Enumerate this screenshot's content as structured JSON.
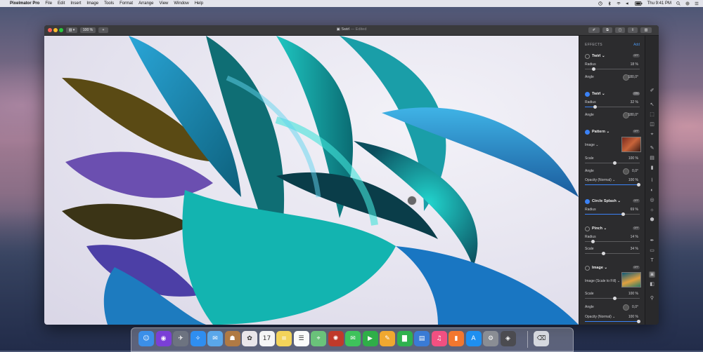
{
  "menubar": {
    "apple": "",
    "app_name": "Pixelmator Pro",
    "items": [
      "File",
      "Edit",
      "Insert",
      "Image",
      "Tools",
      "Format",
      "Arrange",
      "View",
      "Window",
      "Help"
    ],
    "clock": "Thu 9:41 PM",
    "icons": [
      "time-machine-icon",
      "bluetooth-icon",
      "wifi-icon",
      "volume-icon",
      "battery-icon",
      "search-icon",
      "avatar-icon",
      "list-icon"
    ]
  },
  "window": {
    "title": "Swirl",
    "title_suffix": "— Edited",
    "zoom": "100 %",
    "zoom_add": "+",
    "view_btn": "▥ ▾"
  },
  "sidebar": {
    "header": "EFFECTS",
    "add": "Add",
    "effects": [
      {
        "name": "Twirl ⌄",
        "enabled": false,
        "toggle": "OFF",
        "params": [
          {
            "label": "Radius",
            "value": "18 %",
            "pos": 0.18
          },
          {
            "label": "Angle",
            "value": "180,0°",
            "dial": true
          }
        ]
      },
      {
        "name": "Twirl ⌄",
        "enabled": true,
        "toggle": "ON",
        "params": [
          {
            "label": "Radius",
            "value": "32 %",
            "pos": 0.32
          },
          {
            "label": "Angle",
            "value": "180,0°",
            "dial": true
          }
        ]
      },
      {
        "name": "Pattern ⌄",
        "enabled": true,
        "toggle": "OFF",
        "params": [
          {
            "label": "Image ⌄",
            "thumb": true
          },
          {
            "label": "Scale",
            "value": "100 %",
            "pos": 1.0
          },
          {
            "label": "Angle",
            "value": "0,0°",
            "dial": true
          },
          {
            "label": "Opacity (Normal) ⌄",
            "value": "100 %",
            "pos": 1.0
          }
        ]
      },
      {
        "name": "Circle Splash ⌄",
        "enabled": true,
        "toggle": "OFF",
        "params": [
          {
            "label": "Radius",
            "value": "69 %",
            "pos": 0.69
          }
        ]
      },
      {
        "name": "Pinch ⌄",
        "enabled": false,
        "toggle": "OFF",
        "params": [
          {
            "label": "Radius",
            "value": "14 %",
            "pos": 0.14
          },
          {
            "label": "Scale",
            "value": "34 %",
            "pos": 0.34
          }
        ]
      },
      {
        "name": "Image ⌄",
        "enabled": false,
        "toggle": "OFF",
        "params": [
          {
            "label": "Image (Scale to Fill) ⌄",
            "thumb": true
          },
          {
            "label": "Scale",
            "value": "100 %",
            "pos": 1.0
          },
          {
            "label": "Angle",
            "value": "0,0°",
            "dial": true
          },
          {
            "label": "Opacity (Normal) ⌄",
            "value": "100 %",
            "pos": 1.0
          }
        ]
      }
    ]
  },
  "tools": [
    "✐",
    "↖",
    "⬚",
    "◫",
    "⌖",
    "✎",
    "▤",
    "▮",
    "⌇",
    "◐",
    "◎",
    "☼",
    "⬢",
    "✒",
    "▭",
    "T",
    "▣",
    "◧",
    "⚲"
  ],
  "dock": {
    "items": [
      {
        "name": "finder",
        "glyph": "☺",
        "color": "#3b8fe8"
      },
      {
        "name": "siri",
        "glyph": "◉",
        "color": "#7a3fd6"
      },
      {
        "name": "launchpad",
        "glyph": "✈",
        "color": "#6d7380"
      },
      {
        "name": "safari",
        "glyph": "✧",
        "color": "#2f8ef0"
      },
      {
        "name": "mail",
        "glyph": "✉",
        "color": "#5aa7ea"
      },
      {
        "name": "contacts",
        "glyph": "☗",
        "color": "#b07a44"
      },
      {
        "name": "photos",
        "glyph": "✿",
        "color": "#e9e6ea"
      },
      {
        "name": "calendar",
        "glyph": "17",
        "color": "#f5f5f5"
      },
      {
        "name": "notes",
        "glyph": "≡",
        "color": "#f3d35a"
      },
      {
        "name": "reminders",
        "glyph": "☰",
        "color": "#fafafa"
      },
      {
        "name": "maps",
        "glyph": "⌖",
        "color": "#6ac27a"
      },
      {
        "name": "photo-booth",
        "glyph": "✺",
        "color": "#c0392b"
      },
      {
        "name": "messages",
        "glyph": "✉",
        "color": "#3ec25b"
      },
      {
        "name": "facetime",
        "glyph": "▶",
        "color": "#2fae48"
      },
      {
        "name": "pages",
        "glyph": "✎",
        "color": "#f0a830"
      },
      {
        "name": "numbers",
        "glyph": "▇",
        "color": "#2fb24e"
      },
      {
        "name": "keynote",
        "glyph": "▤",
        "color": "#3a7bd5"
      },
      {
        "name": "itunes",
        "glyph": "♫",
        "color": "#f25081"
      },
      {
        "name": "books",
        "glyph": "▮",
        "color": "#f2772f"
      },
      {
        "name": "app-store",
        "glyph": "A",
        "color": "#1e8ff0"
      },
      {
        "name": "system-preferences",
        "glyph": "⚙",
        "color": "#8a8d94"
      },
      {
        "name": "pixelmator-pro",
        "glyph": "◈",
        "color": "#4b4b50"
      },
      {
        "name": "trash",
        "glyph": "⌫",
        "color": "#d5d8de"
      }
    ]
  }
}
